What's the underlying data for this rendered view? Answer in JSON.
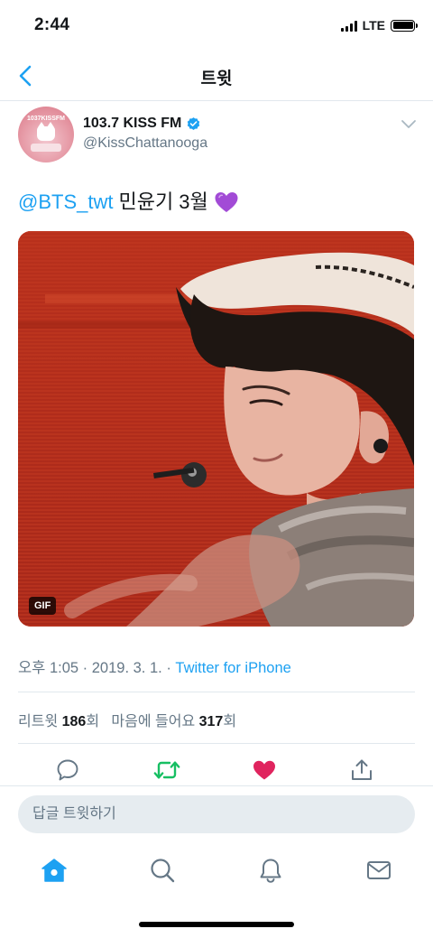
{
  "status_bar": {
    "time": "2:44",
    "network": "LTE"
  },
  "nav": {
    "title": "트윗"
  },
  "author": {
    "avatar_text": "1037KISSFM",
    "name": "103.7 KISS FM",
    "handle": "@KissChattanooga",
    "verified": true
  },
  "tweet": {
    "mention": "@BTS_twt",
    "text": "민윤기 3월",
    "emoji": "purple-heart-icon",
    "media_badge": "GIF",
    "time": "오후 1:05",
    "date": "2019. 3. 1.",
    "separator": "·",
    "source": "Twitter for iPhone"
  },
  "stats": {
    "retweets_label": "리트윗",
    "retweets_count": "186",
    "retweets_unit": "회",
    "likes_label": "마음에 들어요",
    "likes_count": "317",
    "likes_unit": "회"
  },
  "actions": [
    {
      "name": "reply-icon",
      "color": "#657786"
    },
    {
      "name": "retweet-icon",
      "color": "#17bf63",
      "active": true
    },
    {
      "name": "like-icon",
      "color": "#e0245e",
      "active": true
    },
    {
      "name": "share-icon",
      "color": "#657786"
    }
  ],
  "reply": {
    "placeholder": "답글 트윗하기"
  },
  "tabs": [
    {
      "name": "home-icon",
      "active": true
    },
    {
      "name": "search-icon"
    },
    {
      "name": "notifications-icon"
    },
    {
      "name": "messages-icon"
    }
  ],
  "colors": {
    "accent": "#1da1f2",
    "retweet": "#17bf63",
    "like": "#e0245e",
    "secondary_text": "#657786"
  }
}
